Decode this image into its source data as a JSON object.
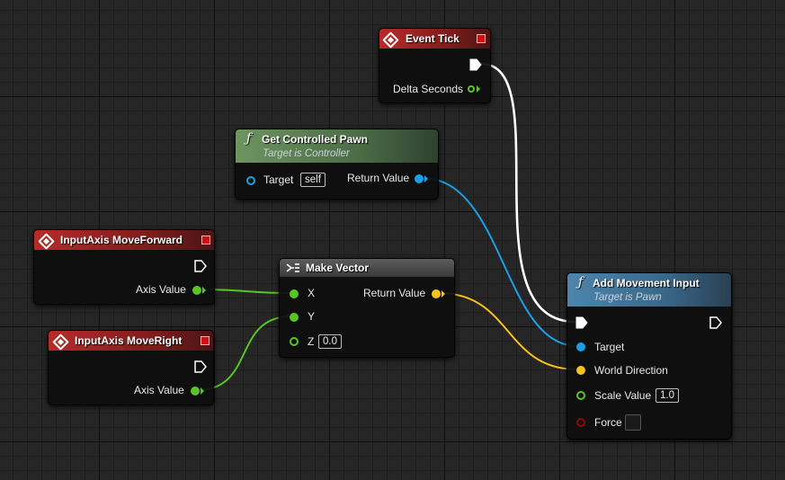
{
  "colors": {
    "exec": "#ffffff",
    "float": "#59c524",
    "object": "#1aa0e6",
    "vector": "#f7c21e",
    "bool": "#8c0a0a",
    "event_header": "#a52626",
    "pure_header": "#5d7f54",
    "function_header": "#4479a0"
  },
  "nodes": {
    "event_tick": {
      "title": "Event Tick",
      "icon": "event-diamond-icon",
      "pins": {
        "delta_seconds": "Delta Seconds"
      }
    },
    "get_controlled_pawn": {
      "title": "Get Controlled Pawn",
      "subtitle": "Target is Controller",
      "icon": "function-f-icon",
      "pins": {
        "target": "Target",
        "target_default": "self",
        "return_value": "Return Value"
      }
    },
    "input_move_forward": {
      "title": "InputAxis MoveForward",
      "icon": "event-diamond-icon",
      "pins": {
        "axis_value": "Axis Value"
      }
    },
    "input_move_right": {
      "title": "InputAxis MoveRight",
      "icon": "event-diamond-icon",
      "pins": {
        "axis_value": "Axis Value"
      }
    },
    "make_vector": {
      "title": "Make Vector",
      "icon": "make-struct-icon",
      "pins": {
        "x": "X",
        "y": "Y",
        "z": "Z",
        "z_default": "0.0",
        "return_value": "Return Value"
      }
    },
    "add_movement_input": {
      "title": "Add Movement Input",
      "subtitle": "Target is Pawn",
      "icon": "function-f-icon",
      "pins": {
        "target": "Target",
        "world_direction": "World Direction",
        "scale_value": "Scale Value",
        "scale_default": "1.0",
        "force": "Force"
      }
    }
  }
}
